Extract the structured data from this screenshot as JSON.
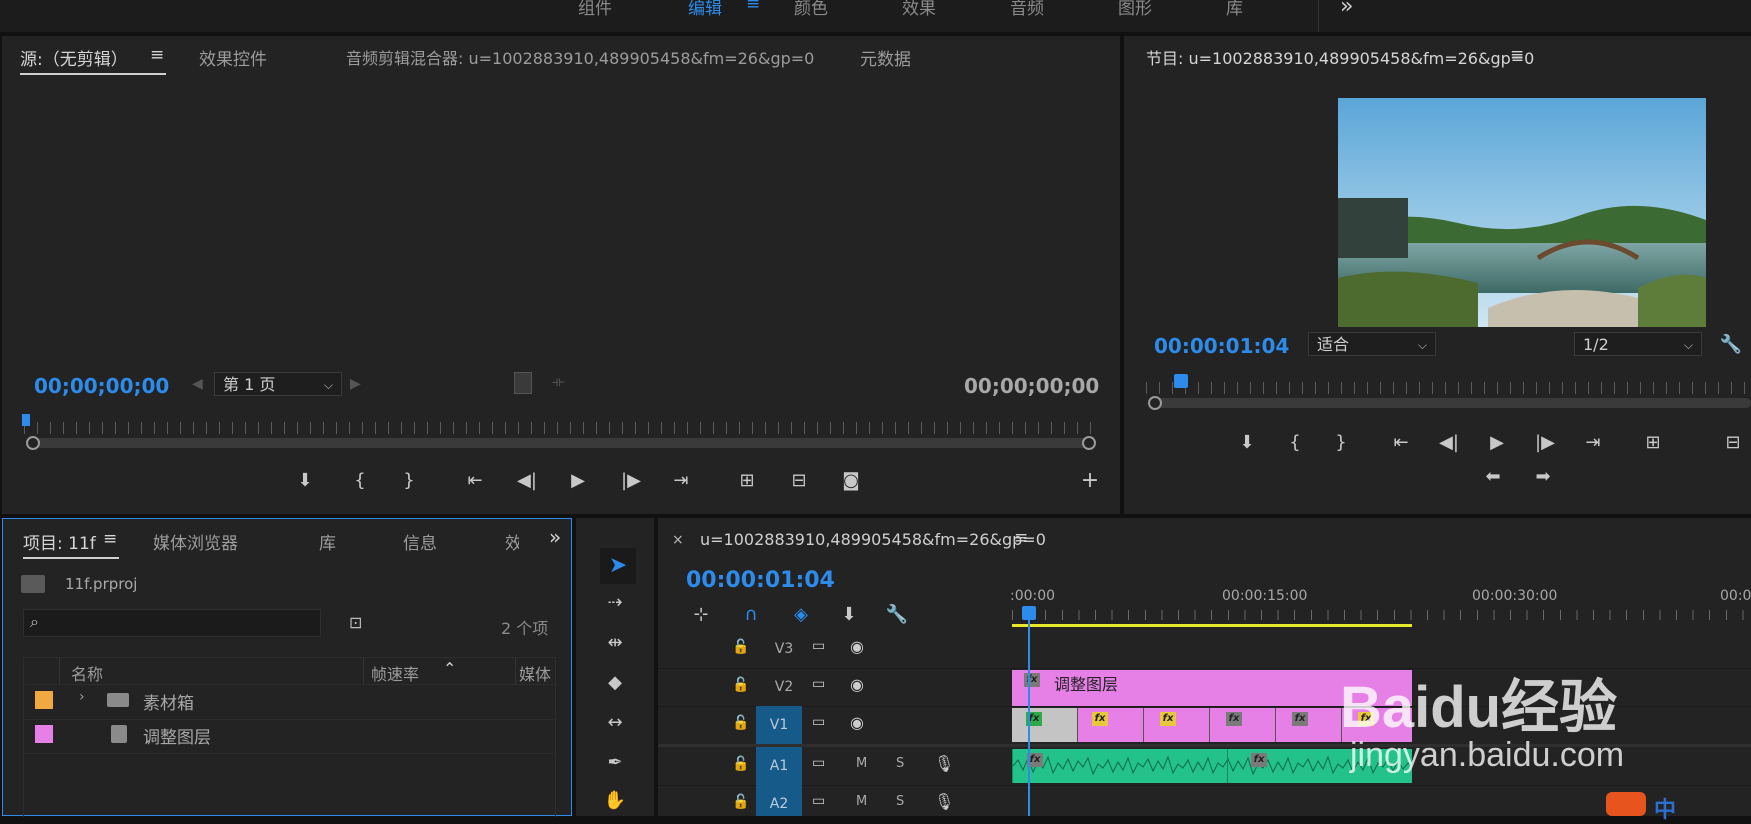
{
  "workspace_tabs": [
    "组件",
    "编辑",
    "颜色",
    "效果",
    "音频",
    "图形",
    "库"
  ],
  "workspace_active": "编辑",
  "workspace_more": "»",
  "menu_glyph": "≡",
  "source_panel": {
    "tabs": [
      "源:（无剪辑）",
      "效果控件",
      "音频剪辑混合器: u=1002883910,489905458&fm=26&gp=0",
      "元数据"
    ],
    "timecode_in": "00;00;00;00",
    "timecode_out": "00;00;00;00",
    "page_select": "第 1 页"
  },
  "program_panel": {
    "title": "节目: u=1002883910,489905458&fm=26&gp=0",
    "timecode": "00:00:01:04",
    "fit_select": "适合",
    "res_select": "1/2"
  },
  "project_panel": {
    "tabs": [
      "项目: 11f",
      "媒体浏览器",
      "库",
      "信息",
      "效"
    ],
    "project_file": "11f.prproj",
    "item_count": "2 个项",
    "search_placeholder": "",
    "columns": [
      "名称",
      "帧速率",
      "媒体"
    ],
    "rows": [
      {
        "name": "素材箱",
        "color": "#f0a840",
        "icon": "folder-icon"
      },
      {
        "name": "调整图层",
        "color": "#e680e6",
        "icon": "adjustment-layer-icon"
      }
    ]
  },
  "timeline": {
    "sequence_name": "u=1002883910,489905458&fm=26&gp=0",
    "close": "×",
    "timecode": "00:00:01:04",
    "ruler_labels": [
      ":00:00",
      "00:00:15:00",
      "00:00:30:00",
      "00:0"
    ],
    "tracks": [
      {
        "id": "V3",
        "kind": "video"
      },
      {
        "id": "V2",
        "kind": "video"
      },
      {
        "id": "V1",
        "kind": "video",
        "targeted": true
      },
      {
        "id": "A1",
        "kind": "audio",
        "targeted": true,
        "m": "M",
        "s": "S"
      },
      {
        "id": "A2",
        "kind": "audio",
        "targeted": true,
        "m": "M",
        "s": "S"
      }
    ],
    "adjustment_clip_label": "调整图层",
    "fx_label": "fx",
    "colors": {
      "adjustment": "#e680e6",
      "audio": "#23c28a",
      "work_area": "#e8e82a",
      "playhead": "#2d8ceb"
    }
  },
  "watermark": {
    "text": "Baidu经验",
    "url": "jingyan.baidu.com"
  },
  "corner_logo": "中"
}
